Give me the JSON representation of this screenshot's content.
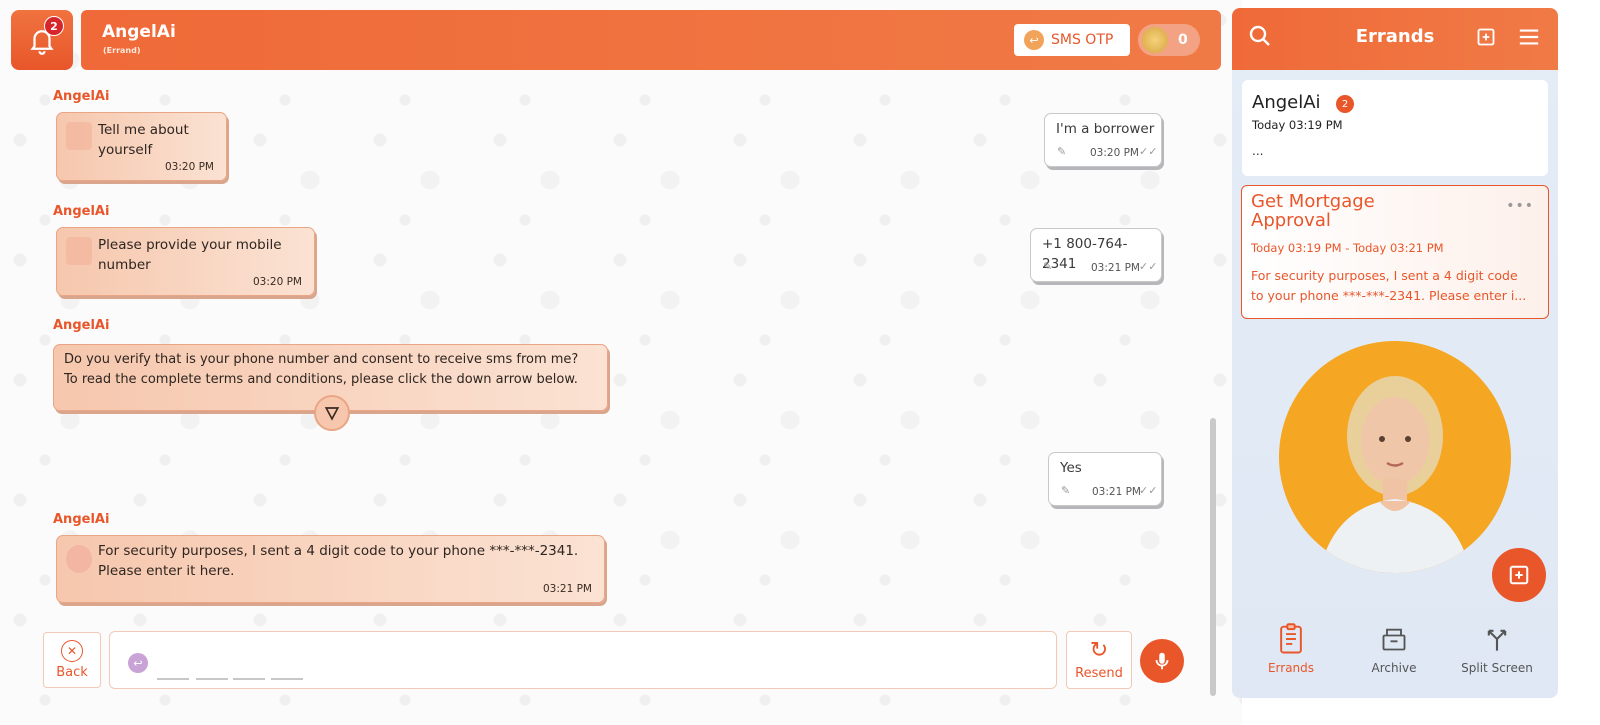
{
  "header": {
    "notification_count": "2",
    "title": "AngelAi",
    "subtitle": "(Errand)",
    "sms_otp_label": "SMS OTP",
    "coin_count": "0"
  },
  "messages": [
    {
      "side": "left",
      "sender": "AngelAi",
      "text_line1": "Tell me about",
      "text_line2": "yourself",
      "time": "03:20 PM"
    },
    {
      "side": "right",
      "text": "I'm a borrower",
      "time": "03:20 PM"
    },
    {
      "side": "left",
      "sender": "AngelAi",
      "text_line1": "Please provide your mobile",
      "text_line2": "number",
      "time": "03:20 PM"
    },
    {
      "side": "right",
      "text": "+1 800-764-2341",
      "time": "03:21 PM"
    },
    {
      "side": "left",
      "sender": "AngelAi",
      "text_line1": "Do you verify that is your phone number and consent to receive sms from me?",
      "text_line2": "To read the complete terms and conditions, please click the down arrow below."
    },
    {
      "side": "right",
      "text": "Yes",
      "time": "03:21 PM"
    },
    {
      "side": "left",
      "sender": "AngelAi",
      "text_line1": "For security purposes, I sent a 4 digit code to your phone ***-***-2341.",
      "text_line2": "Please enter it here.",
      "time": "03:21 PM"
    }
  ],
  "input": {
    "back_label": "Back",
    "resend_label": "Resend"
  },
  "sidebar": {
    "title": "Errands",
    "card1": {
      "name": "AngelAi",
      "badge": "2",
      "time": "Today 03:19 PM",
      "preview": "..."
    },
    "card2": {
      "title": "Get Mortgage Approval",
      "time": "Today 03:19 PM - Today 03:21 PM",
      "preview_line1": "For security purposes, I sent a 4 digit code",
      "preview_line2": "to your phone ***-***-2341. Please enter i..."
    },
    "nav": [
      {
        "label": "Errands",
        "icon": "errands-icon"
      },
      {
        "label": "Archive",
        "icon": "archive-icon"
      },
      {
        "label": "Split Screen",
        "icon": "split-screen-icon"
      }
    ]
  },
  "colors": {
    "accent": "#e8562a",
    "bubble": "#f6c7ad",
    "avatar_bg": "#f5a623"
  }
}
